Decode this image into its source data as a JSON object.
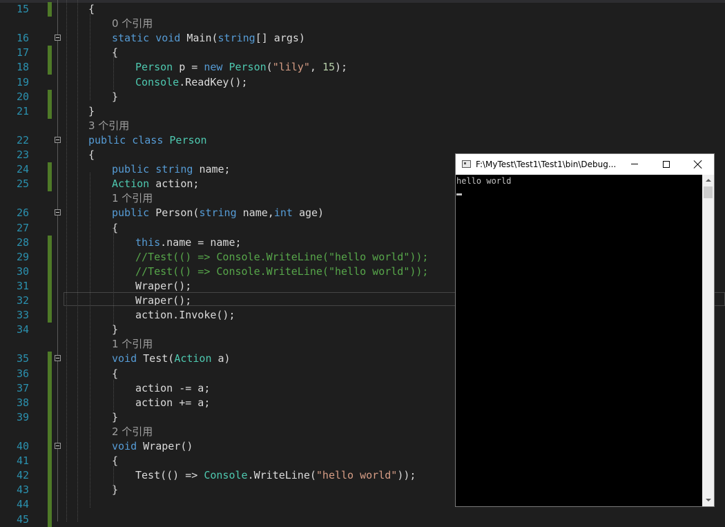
{
  "editor": {
    "rows": [
      {
        "type": "code",
        "ln": "15",
        "indent": 0,
        "fold": false,
        "tokens": [
          {
            "t": "{",
            "c": "pl"
          }
        ]
      },
      {
        "type": "lens",
        "indent": 1,
        "text": "0 个引用"
      },
      {
        "type": "code",
        "ln": "16",
        "indent": 1,
        "fold": true,
        "tokens": [
          {
            "t": "static ",
            "c": "kw"
          },
          {
            "t": "void ",
            "c": "kw"
          },
          {
            "t": "Main(",
            "c": "pl"
          },
          {
            "t": "string",
            "c": "kw"
          },
          {
            "t": "[] args)",
            "c": "pl"
          }
        ]
      },
      {
        "type": "code",
        "ln": "17",
        "indent": 1,
        "fold": false,
        "tokens": [
          {
            "t": "{",
            "c": "pl"
          }
        ]
      },
      {
        "type": "code",
        "ln": "18",
        "indent": 2,
        "fold": false,
        "tokens": [
          {
            "t": "Person",
            "c": "ty"
          },
          {
            "t": " p = ",
            "c": "pl"
          },
          {
            "t": "new ",
            "c": "kw"
          },
          {
            "t": "Person",
            "c": "ty"
          },
          {
            "t": "(",
            "c": "pl"
          },
          {
            "t": "\"lily\"",
            "c": "str"
          },
          {
            "t": ", ",
            "c": "pl"
          },
          {
            "t": "15",
            "c": "num"
          },
          {
            "t": ");",
            "c": "pl"
          }
        ]
      },
      {
        "type": "code",
        "ln": "19",
        "indent": 2,
        "fold": false,
        "tokens": [
          {
            "t": "Console",
            "c": "ty"
          },
          {
            "t": ".ReadKey();",
            "c": "pl"
          }
        ]
      },
      {
        "type": "code",
        "ln": "20",
        "indent": 1,
        "fold": false,
        "tokens": [
          {
            "t": "}",
            "c": "pl"
          }
        ]
      },
      {
        "type": "code",
        "ln": "21",
        "indent": 0,
        "fold": false,
        "tokens": [
          {
            "t": "}",
            "c": "pl"
          }
        ]
      },
      {
        "type": "lens",
        "indent": 0,
        "text": "3 个引用"
      },
      {
        "type": "code",
        "ln": "22",
        "indent": 0,
        "fold": true,
        "tokens": [
          {
            "t": "public ",
            "c": "kw"
          },
          {
            "t": "class ",
            "c": "kw"
          },
          {
            "t": "Person",
            "c": "ty"
          }
        ]
      },
      {
        "type": "code",
        "ln": "23",
        "indent": 0,
        "fold": false,
        "tokens": [
          {
            "t": "{",
            "c": "pl"
          }
        ]
      },
      {
        "type": "code",
        "ln": "24",
        "indent": 1,
        "fold": false,
        "tokens": [
          {
            "t": "public ",
            "c": "kw"
          },
          {
            "t": "string ",
            "c": "kw"
          },
          {
            "t": "name;",
            "c": "pl"
          }
        ]
      },
      {
        "type": "code",
        "ln": "25",
        "indent": 1,
        "fold": false,
        "tokens": [
          {
            "t": "Action",
            "c": "ty"
          },
          {
            "t": " action;",
            "c": "pl"
          }
        ]
      },
      {
        "type": "lens",
        "indent": 1,
        "text": "1 个引用"
      },
      {
        "type": "code",
        "ln": "26",
        "indent": 1,
        "fold": true,
        "tokens": [
          {
            "t": "public ",
            "c": "kw"
          },
          {
            "t": "Person(",
            "c": "pl"
          },
          {
            "t": "string ",
            "c": "kw"
          },
          {
            "t": "name,",
            "c": "pl"
          },
          {
            "t": "int ",
            "c": "kw"
          },
          {
            "t": "age)",
            "c": "pl"
          }
        ]
      },
      {
        "type": "code",
        "ln": "27",
        "indent": 1,
        "fold": false,
        "tokens": [
          {
            "t": "{",
            "c": "pl"
          }
        ]
      },
      {
        "type": "code",
        "ln": "28",
        "indent": 2,
        "fold": false,
        "tokens": [
          {
            "t": "this",
            "c": "kw"
          },
          {
            "t": ".name = name;",
            "c": "pl"
          }
        ]
      },
      {
        "type": "code",
        "ln": "29",
        "indent": 2,
        "fold": false,
        "tokens": [
          {
            "t": "//Test(() => Console.WriteLine(\"hello world\"));",
            "c": "cmt"
          }
        ]
      },
      {
        "type": "code",
        "ln": "30",
        "indent": 2,
        "fold": false,
        "tokens": [
          {
            "t": "//Test(() => Console.WriteLine(\"hello world\"));",
            "c": "cmt"
          }
        ]
      },
      {
        "type": "code",
        "ln": "31",
        "indent": 2,
        "fold": false,
        "tokens": [
          {
            "t": "Wraper();",
            "c": "pl"
          }
        ]
      },
      {
        "type": "code",
        "ln": "32",
        "indent": 2,
        "fold": false,
        "tokens": [
          {
            "t": "Wraper();",
            "c": "pl"
          }
        ]
      },
      {
        "type": "code",
        "ln": "33",
        "indent": 2,
        "fold": false,
        "tokens": [
          {
            "t": "action.Invoke();",
            "c": "pl"
          }
        ]
      },
      {
        "type": "code",
        "ln": "34",
        "indent": 1,
        "fold": false,
        "tokens": [
          {
            "t": "}",
            "c": "pl"
          }
        ]
      },
      {
        "type": "lens",
        "indent": 1,
        "text": "1 个引用"
      },
      {
        "type": "code",
        "ln": "35",
        "indent": 1,
        "fold": true,
        "tokens": [
          {
            "t": "void ",
            "c": "kw"
          },
          {
            "t": "Test(",
            "c": "pl"
          },
          {
            "t": "Action",
            "c": "ty"
          },
          {
            "t": " a)",
            "c": "pl"
          }
        ]
      },
      {
        "type": "code",
        "ln": "36",
        "indent": 1,
        "fold": false,
        "tokens": [
          {
            "t": "{",
            "c": "pl"
          }
        ]
      },
      {
        "type": "code",
        "ln": "37",
        "indent": 2,
        "fold": false,
        "tokens": [
          {
            "t": "action -= a;",
            "c": "pl"
          }
        ]
      },
      {
        "type": "code",
        "ln": "38",
        "indent": 2,
        "fold": false,
        "tokens": [
          {
            "t": "action += a;",
            "c": "pl"
          }
        ]
      },
      {
        "type": "code",
        "ln": "39",
        "indent": 1,
        "fold": false,
        "tokens": [
          {
            "t": "}",
            "c": "pl"
          }
        ]
      },
      {
        "type": "lens",
        "indent": 1,
        "text": "2 个引用"
      },
      {
        "type": "code",
        "ln": "40",
        "indent": 1,
        "fold": true,
        "tokens": [
          {
            "t": "void ",
            "c": "kw"
          },
          {
            "t": "Wraper()",
            "c": "pl"
          }
        ]
      },
      {
        "type": "code",
        "ln": "41",
        "indent": 1,
        "fold": false,
        "tokens": [
          {
            "t": "{",
            "c": "pl"
          }
        ]
      },
      {
        "type": "code",
        "ln": "42",
        "indent": 2,
        "fold": false,
        "tokens": [
          {
            "t": "Test(() => ",
            "c": "pl"
          },
          {
            "t": "Console",
            "c": "ty"
          },
          {
            "t": ".WriteLine(",
            "c": "pl"
          },
          {
            "t": "\"hello world\"",
            "c": "str"
          },
          {
            "t": "));",
            "c": "pl"
          }
        ]
      },
      {
        "type": "code",
        "ln": "43",
        "indent": 1,
        "fold": false,
        "tokens": [
          {
            "t": "}",
            "c": "pl"
          }
        ]
      },
      {
        "type": "code",
        "ln": "44",
        "indent": 1,
        "fold": false,
        "tokens": []
      },
      {
        "type": "code",
        "ln": "45",
        "indent": 1,
        "fold": false,
        "tokens": []
      }
    ]
  },
  "console": {
    "title": "F:\\MyTest\\Test1\\Test1\\bin\\Debug...",
    "output": "hello world"
  }
}
